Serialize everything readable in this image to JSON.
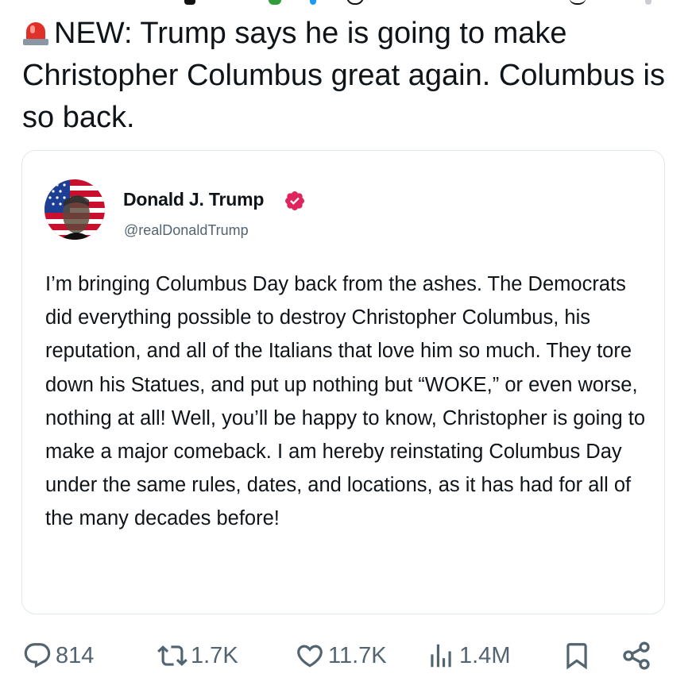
{
  "tweet": {
    "headline": "NEW: Trump says he is going to make Christopher Columbus great again. Columbus is so back.",
    "headline_emoji": "rotating-light-icon"
  },
  "quoted_post": {
    "author_name": "Donald J. Trump",
    "author_handle": "@realDonaldTrump",
    "verified": true,
    "badge_color": "#e0245e",
    "text": "I’m bringing Columbus Day back from the ashes. The Democrats did everything possible to destroy Christopher Columbus, his reputation, and all of the Italians that love him so much. They tore down his Statues, and put up nothing but “WOKE,” or even worse, nothing at all! Well, you’ll be happy to know, Christopher is going to make a major comeback. I am hereby reinstating Columbus Day under the same rules, dates, and locations, as it has had for all of the many decades before!"
  },
  "actions": {
    "replies": "814",
    "reposts": "1.7K",
    "likes": "11.7K",
    "views": "1.4M",
    "icon_color": "#536471",
    "icons": [
      "reply-icon",
      "repost-icon",
      "like-icon",
      "views-icon",
      "bookmark-icon",
      "share-icon"
    ]
  }
}
